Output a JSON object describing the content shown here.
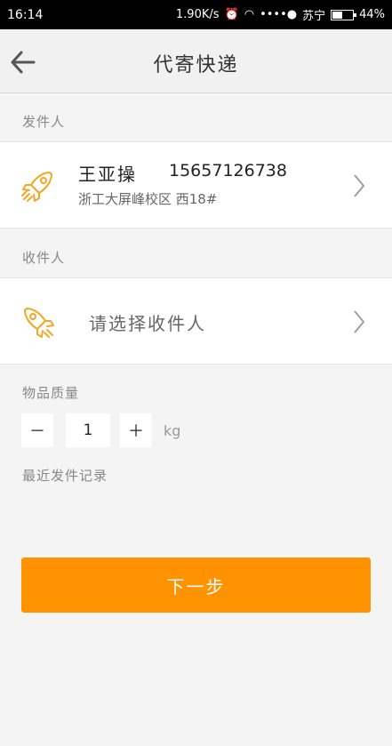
{
  "status_bar": {
    "time": "16:14",
    "speed": "1.90K/s",
    "carrier": "苏宁",
    "battery": "44%"
  },
  "header": {
    "title": "代寄快递"
  },
  "sender": {
    "section_label": "发件人",
    "name": "王亚操",
    "phone": "15657126738",
    "address": "浙工大屏峰校区 西18#"
  },
  "receiver": {
    "section_label": "收件人",
    "placeholder": "请选择收件人"
  },
  "weight": {
    "section_label": "物品质量",
    "decrement_label": "－",
    "value": "1",
    "increment_label": "＋",
    "unit": "kg"
  },
  "history": {
    "label": "最近发件记录"
  },
  "actions": {
    "next_label": "下一步"
  },
  "colors": {
    "accent": "#ff9200",
    "icon": "#f5a623"
  }
}
